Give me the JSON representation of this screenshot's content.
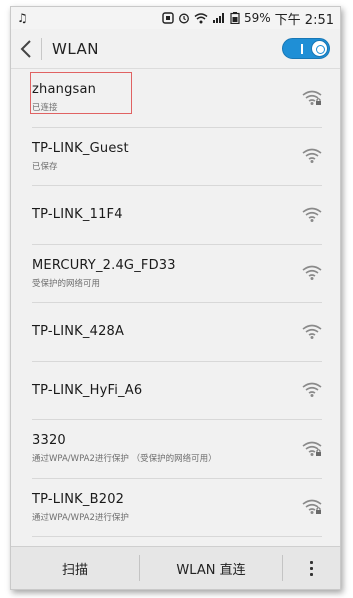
{
  "status_bar": {
    "music_icon": "music-note-icon",
    "battery_percent": "59%",
    "time": "下午 2:51"
  },
  "header": {
    "title": "WLAN",
    "toggle_state": "on"
  },
  "networks": [
    {
      "name": "zhangsan",
      "status": "已连接",
      "secured": true,
      "selected": true
    },
    {
      "name": "TP-LINK_Guest",
      "status": "已保存",
      "secured": false
    },
    {
      "name": "TP-LINK_11F4",
      "status": "",
      "secured": false
    },
    {
      "name": "MERCURY_2.4G_FD33",
      "status": "受保护的网络可用",
      "secured": false
    },
    {
      "name": "TP-LINK_428A",
      "status": "",
      "secured": false
    },
    {
      "name": "TP-LINK_HyFi_A6",
      "status": "",
      "secured": false
    },
    {
      "name": "3320",
      "status": "通过WPA/WPA2进行保护 （受保护的网络可用）",
      "secured": true
    },
    {
      "name": "TP-LINK_B202",
      "status": "通过WPA/WPA2进行保护",
      "secured": true
    }
  ],
  "bottom_bar": {
    "scan_label": "扫描",
    "direct_label": "WLAN 直连"
  },
  "colors": {
    "accent": "#1f8fd6",
    "highlight_border": "#e06262"
  }
}
